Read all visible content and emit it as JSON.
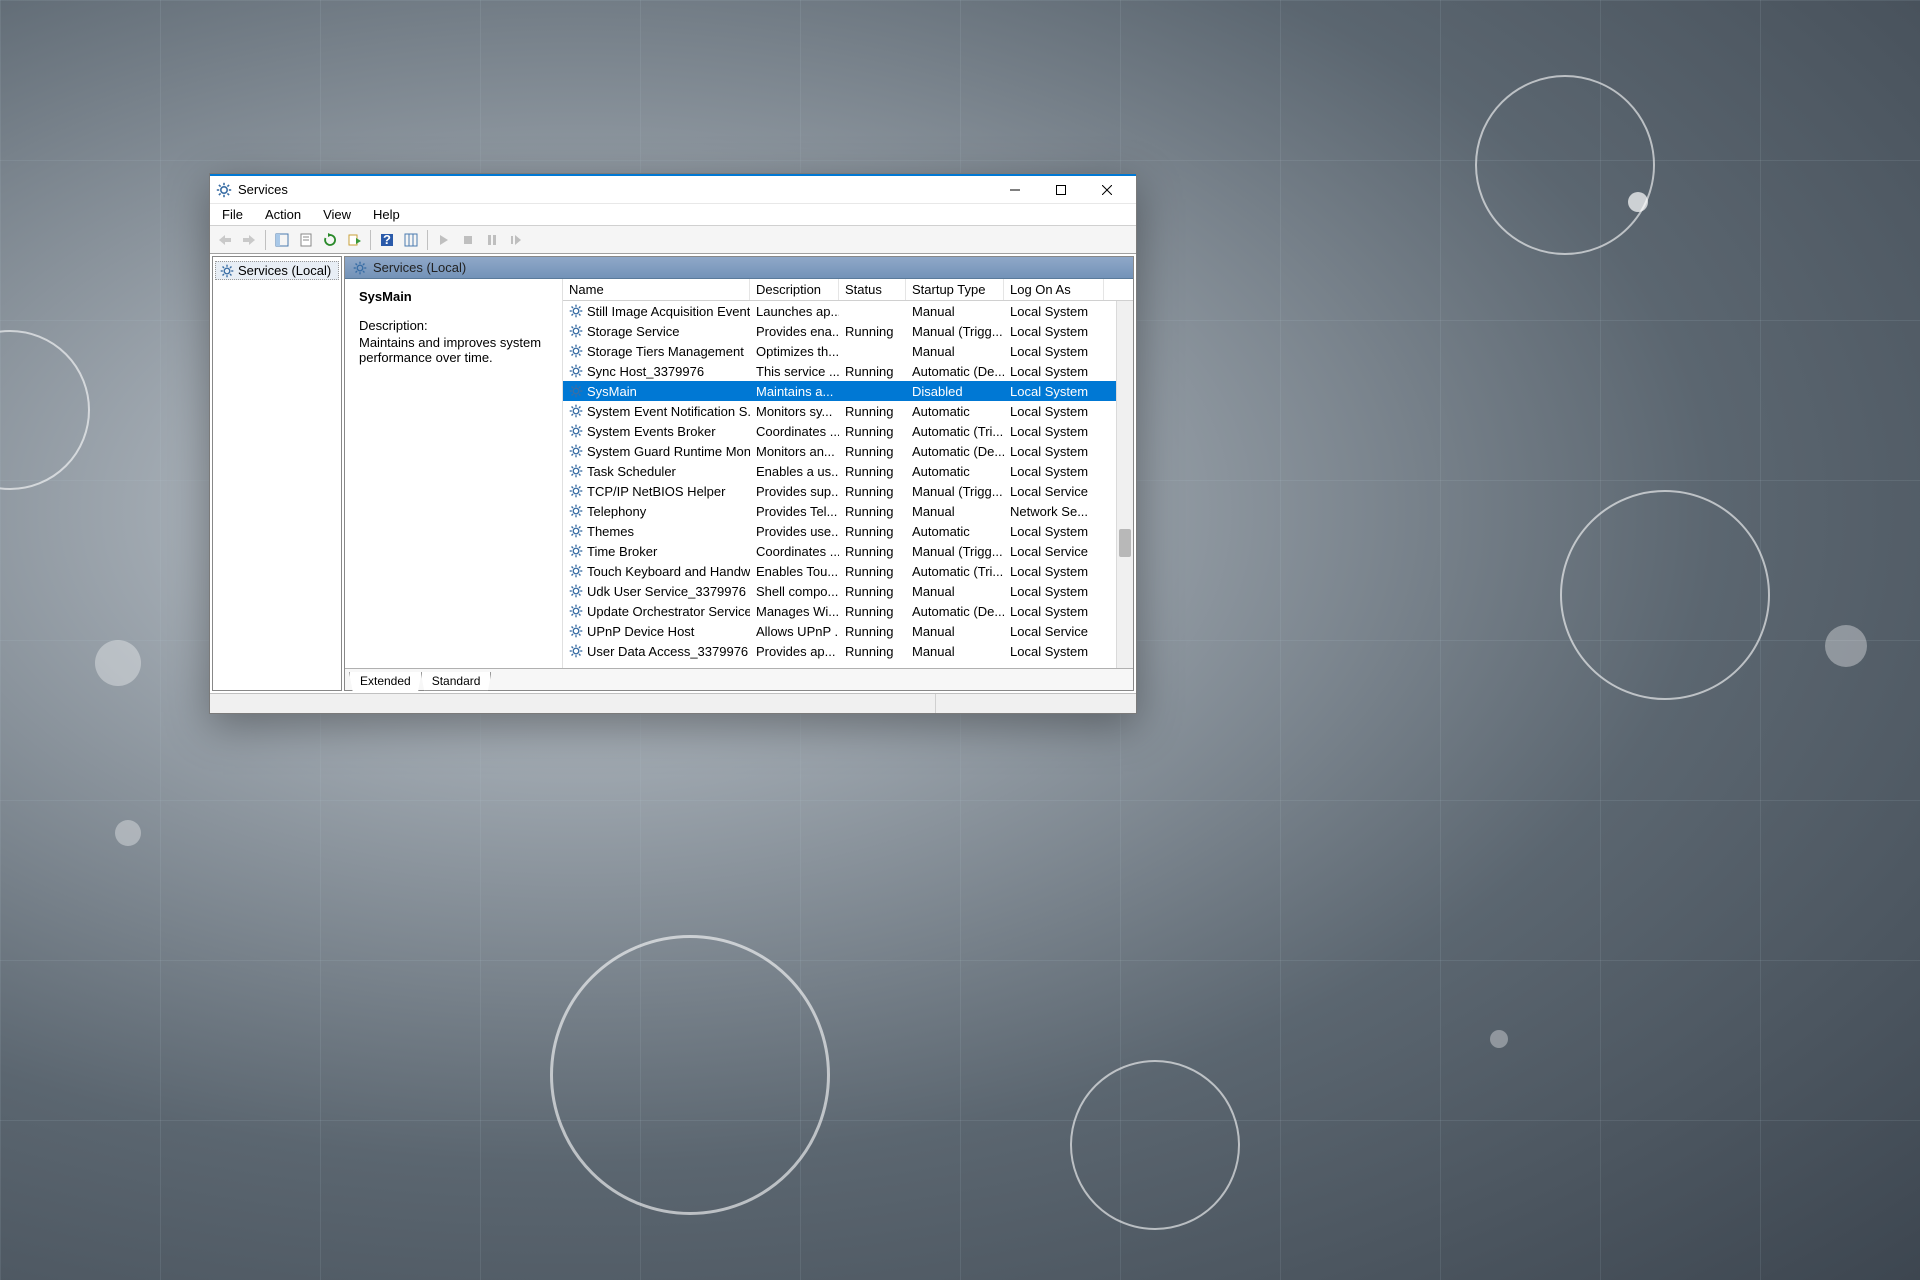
{
  "window": {
    "title": "Services"
  },
  "menu": [
    "File",
    "Action",
    "View",
    "Help"
  ],
  "tree": {
    "root": "Services (Local)"
  },
  "main": {
    "header": "Services (Local)"
  },
  "detail": {
    "selected_name": "SysMain",
    "desc_label": "Description:",
    "desc_text": "Maintains and improves system performance over time."
  },
  "columns": {
    "name": "Name",
    "description": "Description",
    "status": "Status",
    "startup": "Startup Type",
    "logon": "Log On As"
  },
  "rows": [
    {
      "name": "Still Image Acquisition Events",
      "desc": "Launches ap...",
      "status": "",
      "startup": "Manual",
      "logon": "Local System",
      "sel": false
    },
    {
      "name": "Storage Service",
      "desc": "Provides ena...",
      "status": "Running",
      "startup": "Manual (Trigg...",
      "logon": "Local System",
      "sel": false
    },
    {
      "name": "Storage Tiers Management",
      "desc": "Optimizes th...",
      "status": "",
      "startup": "Manual",
      "logon": "Local System",
      "sel": false
    },
    {
      "name": "Sync Host_3379976",
      "desc": "This service ...",
      "status": "Running",
      "startup": "Automatic (De...",
      "logon": "Local System",
      "sel": false
    },
    {
      "name": "SysMain",
      "desc": "Maintains a...",
      "status": "",
      "startup": "Disabled",
      "logon": "Local System",
      "sel": true
    },
    {
      "name": "System Event Notification S...",
      "desc": "Monitors sy...",
      "status": "Running",
      "startup": "Automatic",
      "logon": "Local System",
      "sel": false
    },
    {
      "name": "System Events Broker",
      "desc": "Coordinates ...",
      "status": "Running",
      "startup": "Automatic (Tri...",
      "logon": "Local System",
      "sel": false
    },
    {
      "name": "System Guard Runtime Mon...",
      "desc": "Monitors an...",
      "status": "Running",
      "startup": "Automatic (De...",
      "logon": "Local System",
      "sel": false
    },
    {
      "name": "Task Scheduler",
      "desc": "Enables a us...",
      "status": "Running",
      "startup": "Automatic",
      "logon": "Local System",
      "sel": false
    },
    {
      "name": "TCP/IP NetBIOS Helper",
      "desc": "Provides sup...",
      "status": "Running",
      "startup": "Manual (Trigg...",
      "logon": "Local Service",
      "sel": false
    },
    {
      "name": "Telephony",
      "desc": "Provides Tel...",
      "status": "Running",
      "startup": "Manual",
      "logon": "Network Se...",
      "sel": false
    },
    {
      "name": "Themes",
      "desc": "Provides use...",
      "status": "Running",
      "startup": "Automatic",
      "logon": "Local System",
      "sel": false
    },
    {
      "name": "Time Broker",
      "desc": "Coordinates ...",
      "status": "Running",
      "startup": "Manual (Trigg...",
      "logon": "Local Service",
      "sel": false
    },
    {
      "name": "Touch Keyboard and Handw...",
      "desc": "Enables Tou...",
      "status": "Running",
      "startup": "Automatic (Tri...",
      "logon": "Local System",
      "sel": false
    },
    {
      "name": "Udk User Service_3379976",
      "desc": "Shell compo...",
      "status": "Running",
      "startup": "Manual",
      "logon": "Local System",
      "sel": false
    },
    {
      "name": "Update Orchestrator Service",
      "desc": "Manages Wi...",
      "status": "Running",
      "startup": "Automatic (De...",
      "logon": "Local System",
      "sel": false
    },
    {
      "name": "UPnP Device Host",
      "desc": "Allows UPnP ...",
      "status": "Running",
      "startup": "Manual",
      "logon": "Local Service",
      "sel": false
    },
    {
      "name": "User Data Access_3379976",
      "desc": "Provides ap...",
      "status": "Running",
      "startup": "Manual",
      "logon": "Local System",
      "sel": false
    }
  ],
  "tabs": {
    "extended": "Extended",
    "standard": "Standard"
  }
}
